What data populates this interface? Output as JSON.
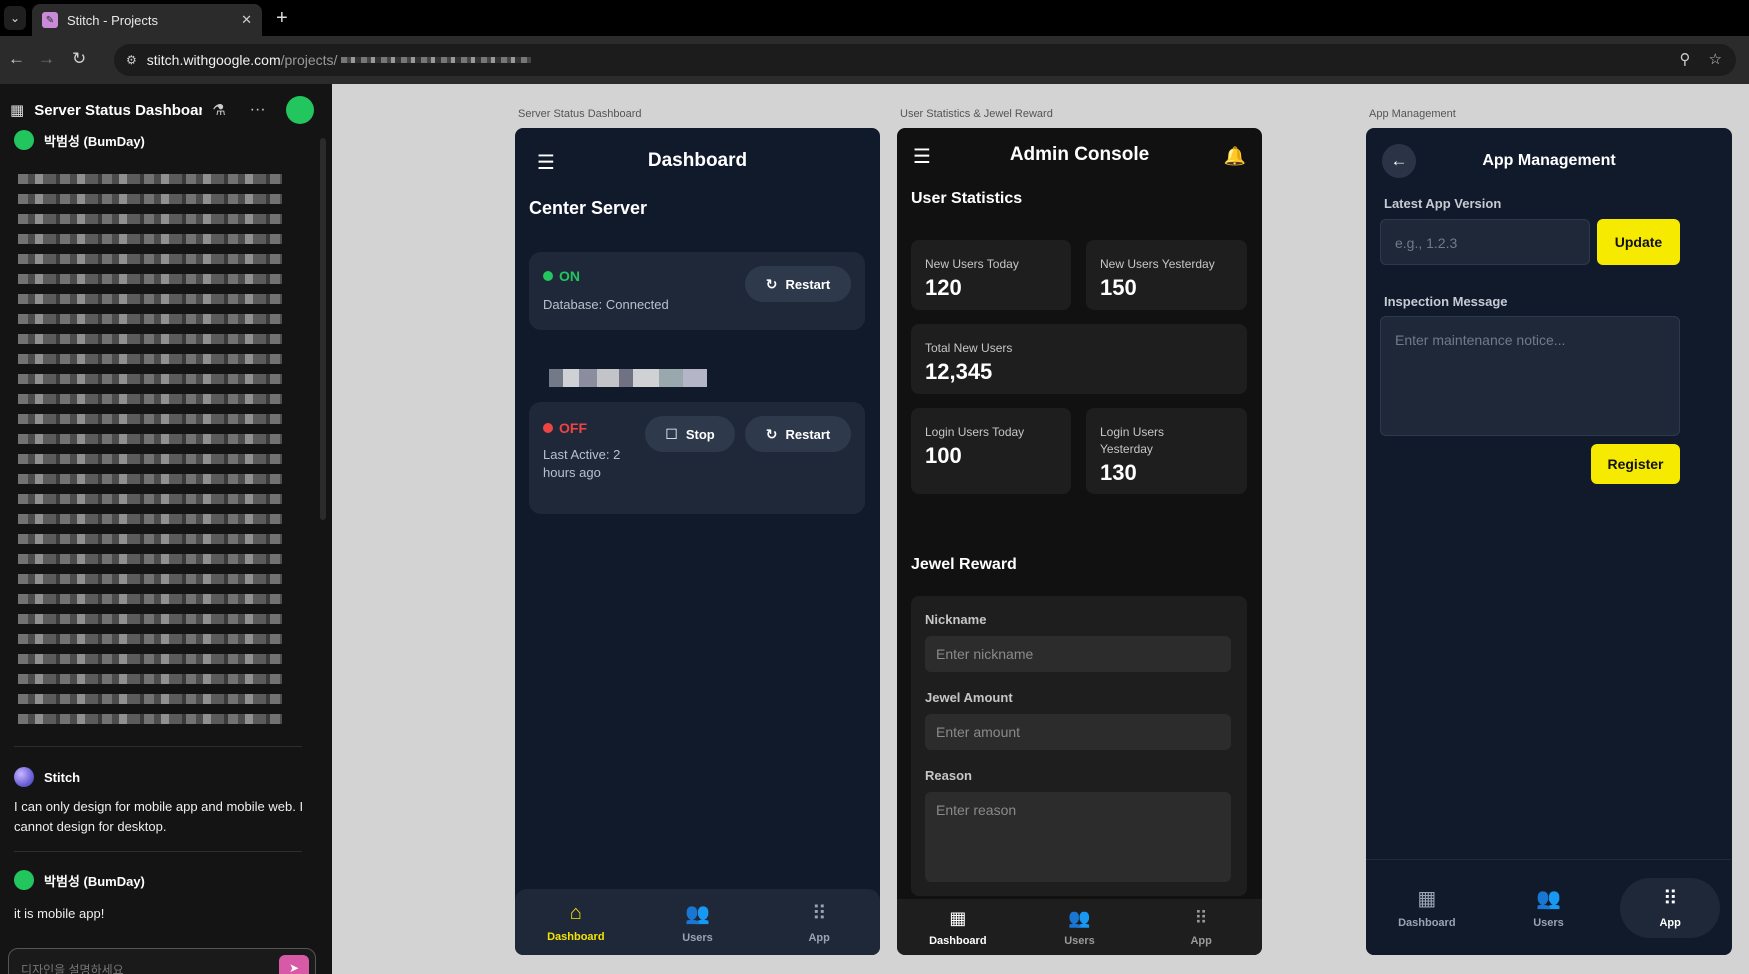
{
  "browser": {
    "tab_title": "Stitch - Projects",
    "url_host": "stitch.withgoogle.com",
    "url_path": "/projects/"
  },
  "sidebar": {
    "project_title": "Server Status Dashboard",
    "messages": [
      {
        "author": "박범성 (BumDay)",
        "text": ""
      },
      {
        "author": "Stitch",
        "text": "I can only design for mobile app and mobile web. I cannot design for desktop."
      },
      {
        "author": "박범성 (BumDay)",
        "text": "it is mobile app!"
      }
    ],
    "prompt_placeholder": "디자인을 설명하세요"
  },
  "frames": {
    "server": {
      "label": "Server Status Dashboard",
      "title": "Dashboard",
      "section": "Center Server",
      "server1": {
        "status": "ON",
        "status_color": "#22c55e",
        "sub": "Database: Connected",
        "restart": "Restart"
      },
      "server2": {
        "status": "OFF",
        "status_color": "#ef4444",
        "sub": "Last Active: 2 hours ago",
        "stop": "Stop",
        "restart": "Restart"
      },
      "nav": [
        {
          "label": "Dashboard",
          "icon": "home-icon",
          "active": true
        },
        {
          "label": "Users",
          "icon": "users-icon",
          "active": false
        },
        {
          "label": "App",
          "icon": "apps-grid-icon",
          "active": false
        }
      ]
    },
    "admin": {
      "label": "User Statistics & Jewel Reward",
      "title": "Admin Console",
      "stats_heading": "User Statistics",
      "stats": {
        "new_today": {
          "label": "New Users Today",
          "value": "120"
        },
        "new_yesterday": {
          "label": "New Users Yesterday",
          "value": "150"
        },
        "total_new": {
          "label": "Total New Users",
          "value": "12,345"
        },
        "login_today": {
          "label": "Login Users Today",
          "value": "100"
        },
        "login_yesterday": {
          "label": "Login Users Yesterday",
          "value": "130"
        }
      },
      "jewel_heading": "Jewel Reward",
      "form": {
        "nickname_label": "Nickname",
        "nickname_ph": "Enter nickname",
        "amount_label": "Jewel Amount",
        "amount_ph": "Enter amount",
        "reason_label": "Reason",
        "reason_ph": "Enter reason"
      },
      "nav": [
        {
          "label": "Dashboard",
          "icon": "dashboard-grid-icon",
          "active": true
        },
        {
          "label": "Users",
          "icon": "users-icon",
          "active": false
        },
        {
          "label": "App",
          "icon": "apps-grid-icon",
          "active": false
        }
      ]
    },
    "app": {
      "label": "App Management",
      "title": "App Management",
      "version_label": "Latest App Version",
      "version_ph": "e.g., 1.2.3",
      "update_btn": "Update",
      "message_label": "Inspection Message",
      "message_ph": "Enter maintenance notice...",
      "register_btn": "Register",
      "nav": [
        {
          "label": "Dashboard",
          "icon": "dashboard-grid-icon",
          "active": false
        },
        {
          "label": "Users",
          "icon": "users-icon",
          "active": false
        },
        {
          "label": "App",
          "icon": "apps-grid-icon",
          "active": true
        }
      ]
    }
  },
  "colors": {
    "accent_yellow": "#f5ea00",
    "online": "#22c55e",
    "offline": "#ef4444"
  }
}
